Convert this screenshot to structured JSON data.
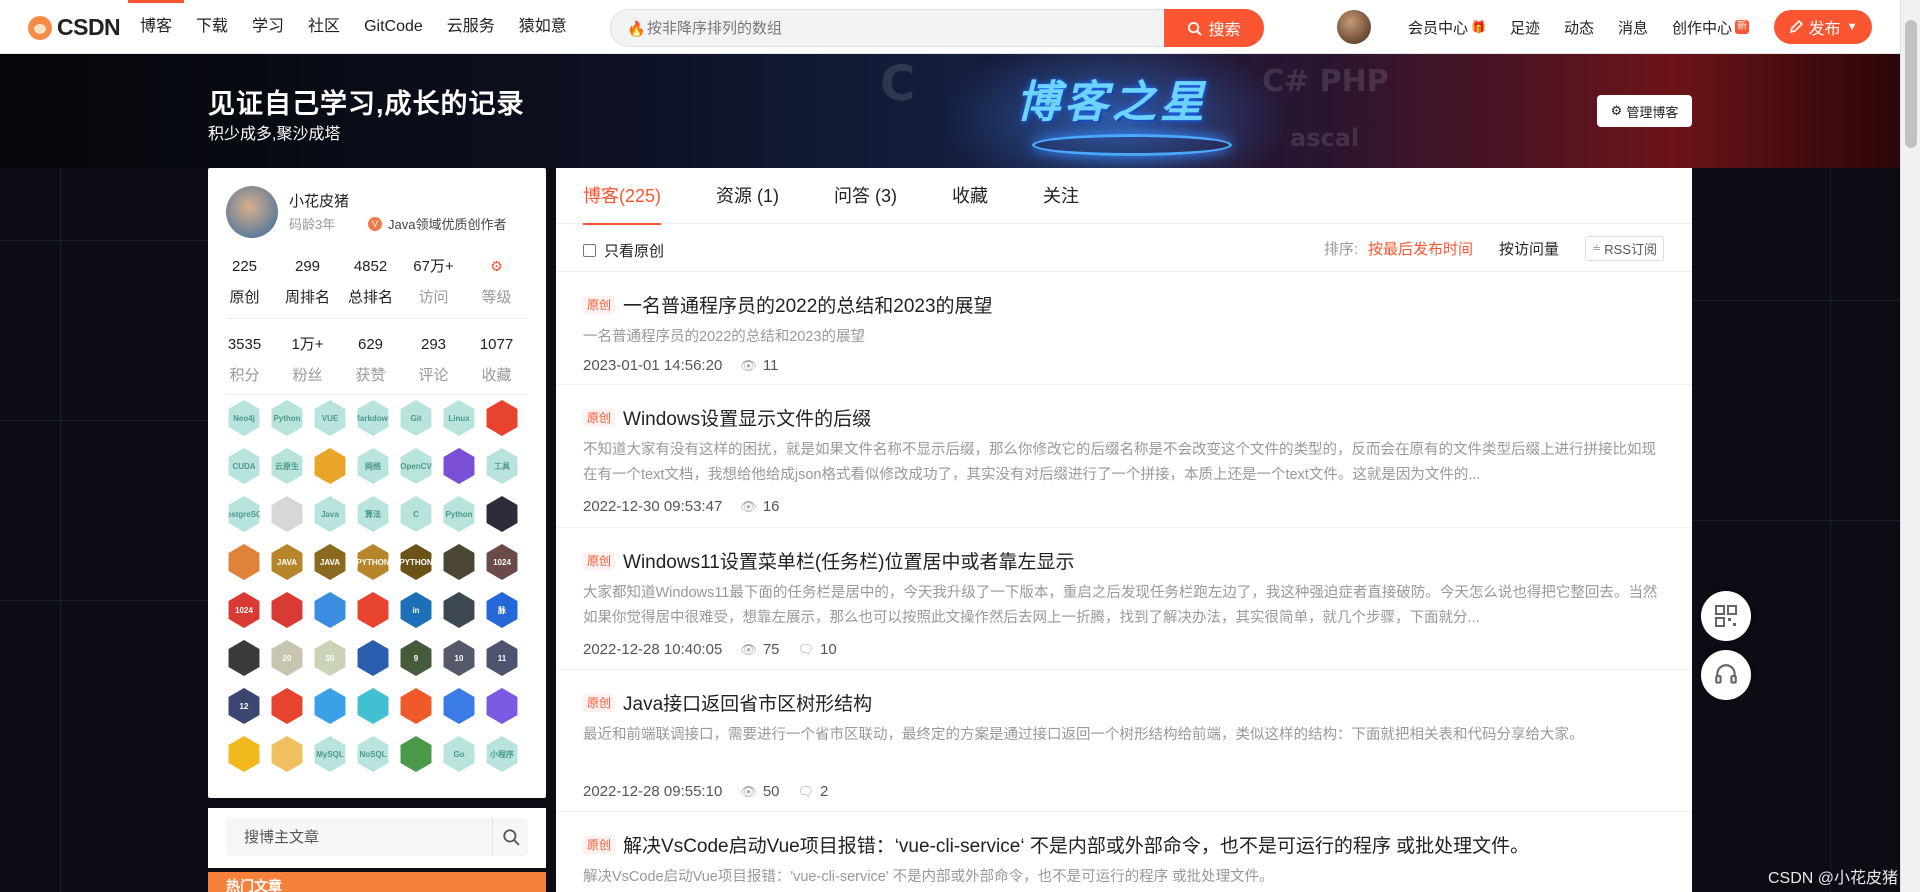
{
  "topbar": {
    "logo_text": "CSDN",
    "nav": [
      "博客",
      "下载",
      "学习",
      "社区",
      "GitCode",
      "云服务",
      "猿如意"
    ],
    "search_placeholder": "按非降序排列的数组",
    "search_button": "搜索",
    "links": [
      "会员中心",
      "足迹",
      "动态",
      "消息",
      "创作中心"
    ],
    "new_badge": "新",
    "publish": "发布"
  },
  "banner": {
    "title": "见证自己学习,成长的记录",
    "subtitle": "积少成多,聚沙成塔",
    "logo_text": "博客之星",
    "manage_button": "管理博客"
  },
  "profile": {
    "name": "小花皮猪",
    "years": "码龄3年",
    "creator": "Java领域优质创作者",
    "stats1": [
      {
        "num": "225",
        "label": "原创"
      },
      {
        "num": "299",
        "label": "周排名"
      },
      {
        "num": "4852",
        "label": "总排名"
      },
      {
        "num": "67万+",
        "label": "访问"
      },
      {
        "num": "",
        "label": "等级"
      }
    ],
    "stats2": [
      {
        "num": "3535",
        "label": "积分"
      },
      {
        "num": "1万+",
        "label": "粉丝"
      },
      {
        "num": "629",
        "label": "获赞"
      },
      {
        "num": "293",
        "label": "评论"
      },
      {
        "num": "1077",
        "label": "收藏"
      }
    ],
    "badges": [
      {
        "t": "Neo4j",
        "c": "#b9e3dd"
      },
      {
        "t": "Python",
        "c": "#b9e3dd"
      },
      {
        "t": "VUE",
        "c": "#b9e3dd"
      },
      {
        "t": "Markdown",
        "c": "#b9e3dd"
      },
      {
        "t": "Git",
        "c": "#b9e3dd"
      },
      {
        "t": "Linux",
        "c": "#b9e3dd"
      },
      {
        "t": "",
        "c": "#e8432f"
      },
      {
        "t": "CUDA",
        "c": "#b9e3dd"
      },
      {
        "t": "云原生",
        "c": "#b9e3dd"
      },
      {
        "t": "",
        "c": "#e9a42a"
      },
      {
        "t": "网络",
        "c": "#b9e3dd"
      },
      {
        "t": "OpenCV",
        "c": "#b9e3dd"
      },
      {
        "t": "",
        "c": "#7a4fd6"
      },
      {
        "t": "工具",
        "c": "#b9e3dd"
      },
      {
        "t": "PostgreSQL",
        "c": "#b9e3dd"
      },
      {
        "t": "",
        "c": "#d7d7d7"
      },
      {
        "t": "Java",
        "c": "#b9e3dd"
      },
      {
        "t": "算法",
        "c": "#b9e3dd"
      },
      {
        "t": "C",
        "c": "#b9e3dd"
      },
      {
        "t": "Python",
        "c": "#b9e3dd"
      },
      {
        "t": "",
        "c": "#2c2c3a"
      },
      {
        "t": "",
        "c": "#e0823a"
      },
      {
        "t": "JAVA",
        "c": "#b8862a"
      },
      {
        "t": "JAVA",
        "c": "#8a6a1e"
      },
      {
        "t": "PYTHON",
        "c": "#b8862a"
      },
      {
        "t": "PYTHON",
        "c": "#6b5317"
      },
      {
        "t": "",
        "c": "#4b4633"
      },
      {
        "t": "1024",
        "c": "#6b4a4a"
      },
      {
        "t": "1024",
        "c": "#d93b34"
      },
      {
        "t": "",
        "c": "#d93b34"
      },
      {
        "t": "",
        "c": "#3a8de0"
      },
      {
        "t": "",
        "c": "#e8432f"
      },
      {
        "t": "in",
        "c": "#1d6fb8"
      },
      {
        "t": "",
        "c": "#3c4752"
      },
      {
        "t": "脉",
        "c": "#2467d6"
      },
      {
        "t": "",
        "c": "#3a3a3a"
      },
      {
        "t": "20",
        "c": "#c8c4b0"
      },
      {
        "t": "50",
        "c": "#c9d4b6"
      },
      {
        "t": "",
        "c": "#2a5fb0"
      },
      {
        "t": "9",
        "c": "#465a3c"
      },
      {
        "t": "10",
        "c": "#555a6a"
      },
      {
        "t": "11",
        "c": "#4e5470"
      },
      {
        "t": "12",
        "c": "#3b4770"
      },
      {
        "t": "",
        "c": "#e8432f"
      },
      {
        "t": "",
        "c": "#3aa0e8"
      },
      {
        "t": "",
        "c": "#40c0d0"
      },
      {
        "t": "",
        "c": "#f05a2a"
      },
      {
        "t": "",
        "c": "#3a7be8"
      },
      {
        "t": "",
        "c": "#7a5ae0"
      },
      {
        "t": "",
        "c": "#f2b91e"
      },
      {
        "t": "",
        "c": "#f0c060"
      },
      {
        "t": "MySQL",
        "c": "#b9e3dd"
      },
      {
        "t": "NoSQL",
        "c": "#b9e3dd"
      },
      {
        "t": "",
        "c": "#4a9a4a"
      },
      {
        "t": "Go",
        "c": "#b9e3dd"
      },
      {
        "t": "小程序",
        "c": "#b9e3dd"
      }
    ]
  },
  "sidebar_search": {
    "placeholder": "搜博主文章"
  },
  "hot": {
    "title": "热门文章"
  },
  "tabs": [
    "博客(225)",
    "资源 (1)",
    "问答 (3)",
    "收藏",
    "关注"
  ],
  "filter": {
    "only_original": "只看原创",
    "sort_label": "排序:",
    "sort_active": "按最后发布时间",
    "sort_other": "按访问量",
    "rss": "RSS订阅"
  },
  "articles": [
    {
      "tag": "原创",
      "title": "一名普通程序员的2022的总结和2023的展望",
      "desc": "一名普通程序员的2022的总结和2023的展望",
      "date": "2023-01-01 14:56:20",
      "views": "11",
      "comments": ""
    },
    {
      "tag": "原创",
      "title": "Windows设置显示文件的后缀",
      "desc": "不知道大家有没有这样的困扰，就是如果文件名称不显示后缀，那么你修改它的后缀名称是不会改变这个文件的类型的，反而会在原有的文件类型后缀上进行拼接比如现在有一个text文档，我想给他给成json格式看似修改成功了，其实没有对后缀进行了一个拼接，本质上还是一个text文件。这就是因为文件的...",
      "date": "2022-12-30 09:53:47",
      "views": "16",
      "comments": ""
    },
    {
      "tag": "原创",
      "title": "Windows11设置菜单栏(任务栏)位置居中或者靠左显示",
      "desc": "大家都知道Windows11最下面的任务栏是居中的，今天我升级了一下版本，重启之后发现任务栏跑左边了，我这种强迫症者直接破防。今天怎么说也得把它整回去。当然如果你觉得居中很难受，想靠左展示，那么也可以按照此文操作然后去网上一折腾，找到了解决办法，其实很简单，就几个步骤，下面就分...",
      "date": "2022-12-28 10:40:05",
      "views": "75",
      "comments": "10"
    },
    {
      "tag": "原创",
      "title": "Java接口返回省市区树形结构",
      "desc": "最近和前端联调接口，需要进行一个省市区联动，最终定的方案是通过接口返回一个树形结构给前端，类似这样的结构：下面就把相关表和代码分享给大家。",
      "date": "2022-12-28 09:55:10",
      "views": "50",
      "comments": "2"
    },
    {
      "tag": "原创",
      "title": "解决VsCode启动Vue项目报错：‘vue-cli-service‘ 不是内部或外部命令，也不是可运行的程序 或批处理文件。",
      "desc": "解决VsCode启动Vue项目报错：'vue-cli-service' 不是内部或外部命令，也不是可运行的程序 或批处理文件。",
      "date": "",
      "views": "",
      "comments": ""
    }
  ],
  "watermark": "CSDN @小花皮猪",
  "colors": {
    "accent": "#fc5531"
  }
}
